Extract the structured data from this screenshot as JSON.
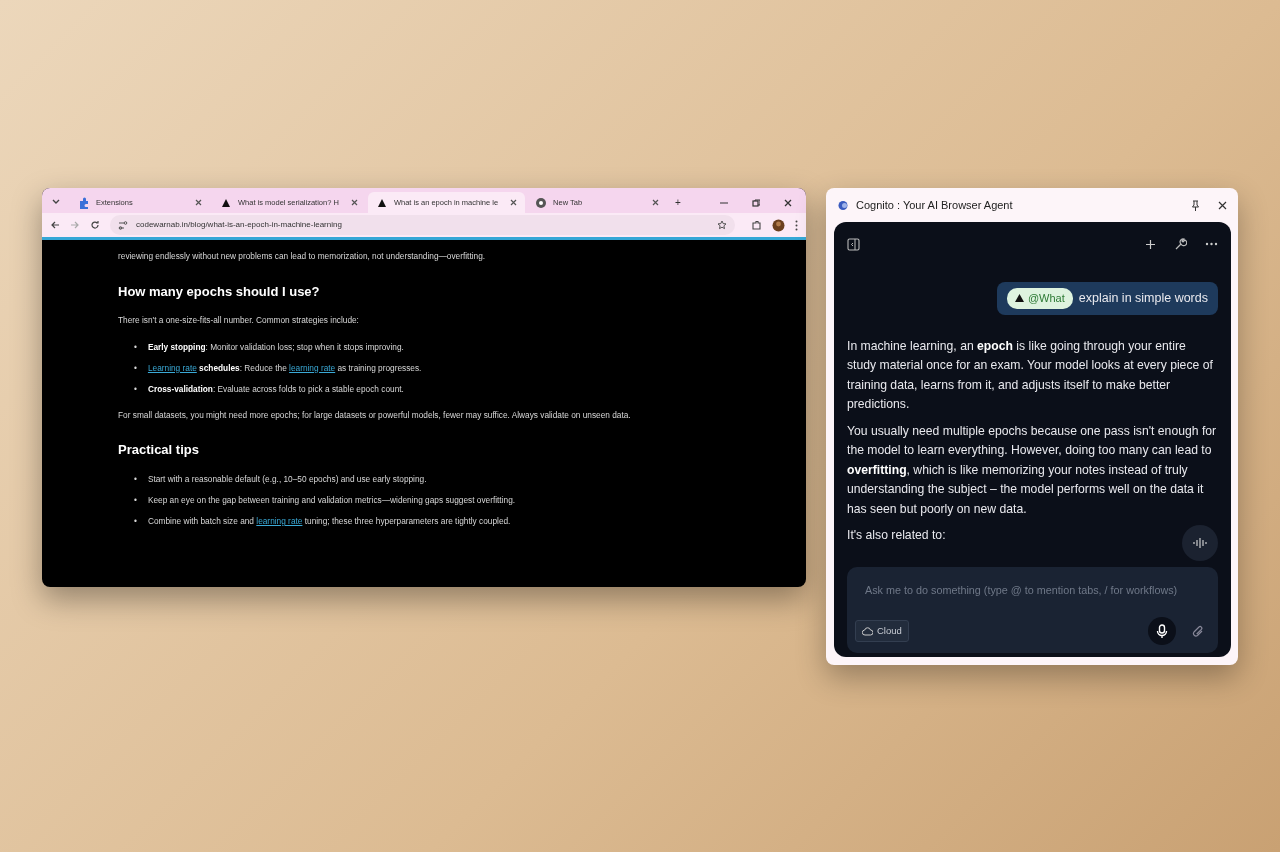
{
  "browser": {
    "tabs": [
      {
        "title": "Extensions",
        "kind": "extensions",
        "selected": false
      },
      {
        "title": "What is model serialization? H",
        "kind": "site",
        "selected": false
      },
      {
        "title": "What is an epoch in machine le",
        "kind": "site",
        "selected": true
      },
      {
        "title": "New Tab",
        "kind": "newtab",
        "selected": false
      }
    ],
    "new_tab": "+",
    "url": "codewarnab.in/blog/what-is-an-epoch-in-machine-learning",
    "article": [
      {
        "kind": "paragraph",
        "text": "reviewing endlessly without new problems can lead to memorization, not understanding—overfitting."
      },
      {
        "kind": "heading",
        "text": "How many epochs should I use?"
      },
      {
        "kind": "paragraph",
        "text": "There isn't a one-size-fits-all number. Common strategies include:"
      },
      {
        "kind": "list",
        "marker": "•",
        "items": [
          [
            {
              "kind": "bold",
              "text": "Early stopping"
            },
            {
              "kind": "plain",
              "text": ": Monitor validation loss; stop when it stops improving."
            }
          ],
          [
            {
              "kind": "link",
              "text": "Learning rate"
            },
            {
              "kind": "bold",
              "text": " schedules"
            },
            {
              "kind": "plain",
              "text": ": Reduce the "
            },
            {
              "kind": "link",
              "text": "learning rate"
            },
            {
              "kind": "plain",
              "text": " as training progresses."
            }
          ],
          [
            {
              "kind": "bold",
              "text": "Cross-validation"
            },
            {
              "kind": "plain",
              "text": ": Evaluate across folds to pick a stable epoch count."
            }
          ]
        ]
      },
      {
        "kind": "paragraph",
        "text": "For small datasets, you might need more epochs; for large datasets or powerful models, fewer may suffice. Always validate on unseen data."
      },
      {
        "kind": "heading",
        "text": "Practical tips"
      },
      {
        "kind": "list",
        "marker": "•",
        "items": [
          [
            {
              "kind": "plain",
              "text": "Start with a reasonable default (e.g., 10–50 epochs) and use early stopping."
            }
          ],
          [
            {
              "kind": "plain",
              "text": "Keep an eye on the gap between training and validation metrics—widening gaps suggest overfitting."
            }
          ],
          [
            {
              "kind": "plain",
              "text": "Combine with batch size and "
            },
            {
              "kind": "link",
              "text": "learning rate"
            },
            {
              "kind": "plain",
              "text": " tuning; these three hyperparameters are tightly coupled."
            }
          ]
        ]
      }
    ]
  },
  "agent": {
    "title": "Cognito : Your AI Browser Agent",
    "user_message": {
      "mention": "@What",
      "text": "explain in simple words"
    },
    "reply": [
      "In machine learning, an **epoch** is like going through your entire study material once for an exam. Your model looks at every piece of training data, learns from it, and adjusts itself to make better predictions.",
      "You usually need multiple epochs because one pass isn't enough for the model to learn everything. However, doing too many can lead to **overfitting**, which is like memorizing your notes instead of truly understanding the subject – the model performs well on the data it has seen but poorly on new data.",
      "It's also related to:"
    ],
    "input": {
      "placeholder": "Ask me to do something (type @ to mention tabs, / for workflows)"
    },
    "mode_button": "Cloud"
  }
}
